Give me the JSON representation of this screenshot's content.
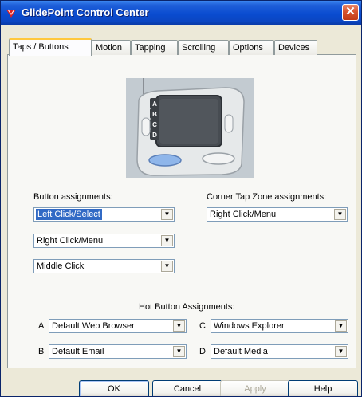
{
  "window": {
    "title": "GlidePoint Control Center",
    "close_symbol": "✕"
  },
  "tabs": [
    {
      "label": "Taps / Buttons",
      "active": true
    },
    {
      "label": "Motion"
    },
    {
      "label": "Tapping"
    },
    {
      "label": "Scrolling"
    },
    {
      "label": "Options"
    },
    {
      "label": "Devices"
    }
  ],
  "pad_image": {
    "button_letters": [
      "A",
      "B",
      "C",
      "D"
    ]
  },
  "button_assignments": {
    "label": "Button assignments:",
    "combos": [
      "Left Click/Select",
      "Right Click/Menu",
      "Middle Click"
    ]
  },
  "corner_tap": {
    "label": "Corner Tap Zone assignments:",
    "value": "Right Click/Menu"
  },
  "hot_buttons": {
    "label": "Hot Button Assignments:",
    "items": [
      {
        "key": "A",
        "value": "Default Web Browser"
      },
      {
        "key": "B",
        "value": "Default Email"
      },
      {
        "key": "C",
        "value": "Windows Explorer"
      },
      {
        "key": "D",
        "value": "Default Media"
      }
    ]
  },
  "buttons": {
    "ok": "OK",
    "cancel": "Cancel",
    "apply": "Apply",
    "help": "Help"
  },
  "icons": {
    "dropdown": "▼"
  },
  "colors": {
    "title_bar": "#0a4cd0",
    "close_button": "#d8542e",
    "selection": "#316ac5"
  }
}
